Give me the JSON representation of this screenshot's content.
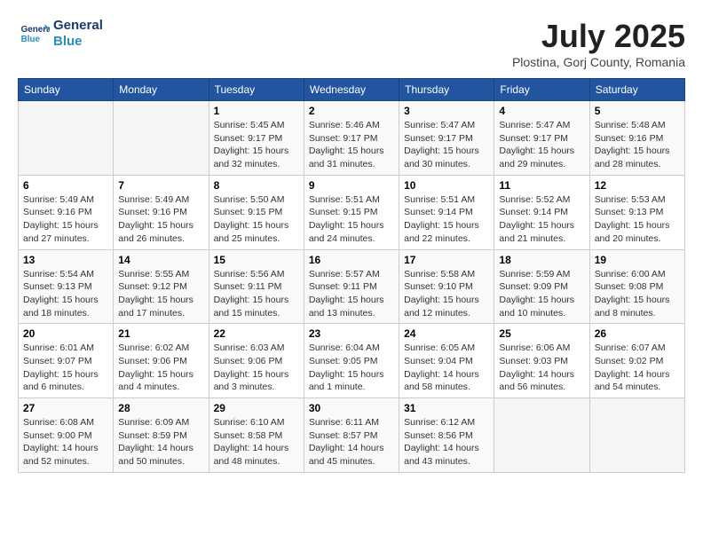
{
  "header": {
    "logo_line1": "General",
    "logo_line2": "Blue",
    "month_title": "July 2025",
    "location": "Plostina, Gorj County, Romania"
  },
  "weekdays": [
    "Sunday",
    "Monday",
    "Tuesday",
    "Wednesday",
    "Thursday",
    "Friday",
    "Saturday"
  ],
  "weeks": [
    [
      {
        "day": "",
        "info": ""
      },
      {
        "day": "",
        "info": ""
      },
      {
        "day": "1",
        "info": "Sunrise: 5:45 AM\nSunset: 9:17 PM\nDaylight: 15 hours\nand 32 minutes."
      },
      {
        "day": "2",
        "info": "Sunrise: 5:46 AM\nSunset: 9:17 PM\nDaylight: 15 hours\nand 31 minutes."
      },
      {
        "day": "3",
        "info": "Sunrise: 5:47 AM\nSunset: 9:17 PM\nDaylight: 15 hours\nand 30 minutes."
      },
      {
        "day": "4",
        "info": "Sunrise: 5:47 AM\nSunset: 9:17 PM\nDaylight: 15 hours\nand 29 minutes."
      },
      {
        "day": "5",
        "info": "Sunrise: 5:48 AM\nSunset: 9:16 PM\nDaylight: 15 hours\nand 28 minutes."
      }
    ],
    [
      {
        "day": "6",
        "info": "Sunrise: 5:49 AM\nSunset: 9:16 PM\nDaylight: 15 hours\nand 27 minutes."
      },
      {
        "day": "7",
        "info": "Sunrise: 5:49 AM\nSunset: 9:16 PM\nDaylight: 15 hours\nand 26 minutes."
      },
      {
        "day": "8",
        "info": "Sunrise: 5:50 AM\nSunset: 9:15 PM\nDaylight: 15 hours\nand 25 minutes."
      },
      {
        "day": "9",
        "info": "Sunrise: 5:51 AM\nSunset: 9:15 PM\nDaylight: 15 hours\nand 24 minutes."
      },
      {
        "day": "10",
        "info": "Sunrise: 5:51 AM\nSunset: 9:14 PM\nDaylight: 15 hours\nand 22 minutes."
      },
      {
        "day": "11",
        "info": "Sunrise: 5:52 AM\nSunset: 9:14 PM\nDaylight: 15 hours\nand 21 minutes."
      },
      {
        "day": "12",
        "info": "Sunrise: 5:53 AM\nSunset: 9:13 PM\nDaylight: 15 hours\nand 20 minutes."
      }
    ],
    [
      {
        "day": "13",
        "info": "Sunrise: 5:54 AM\nSunset: 9:13 PM\nDaylight: 15 hours\nand 18 minutes."
      },
      {
        "day": "14",
        "info": "Sunrise: 5:55 AM\nSunset: 9:12 PM\nDaylight: 15 hours\nand 17 minutes."
      },
      {
        "day": "15",
        "info": "Sunrise: 5:56 AM\nSunset: 9:11 PM\nDaylight: 15 hours\nand 15 minutes."
      },
      {
        "day": "16",
        "info": "Sunrise: 5:57 AM\nSunset: 9:11 PM\nDaylight: 15 hours\nand 13 minutes."
      },
      {
        "day": "17",
        "info": "Sunrise: 5:58 AM\nSunset: 9:10 PM\nDaylight: 15 hours\nand 12 minutes."
      },
      {
        "day": "18",
        "info": "Sunrise: 5:59 AM\nSunset: 9:09 PM\nDaylight: 15 hours\nand 10 minutes."
      },
      {
        "day": "19",
        "info": "Sunrise: 6:00 AM\nSunset: 9:08 PM\nDaylight: 15 hours\nand 8 minutes."
      }
    ],
    [
      {
        "day": "20",
        "info": "Sunrise: 6:01 AM\nSunset: 9:07 PM\nDaylight: 15 hours\nand 6 minutes."
      },
      {
        "day": "21",
        "info": "Sunrise: 6:02 AM\nSunset: 9:06 PM\nDaylight: 15 hours\nand 4 minutes."
      },
      {
        "day": "22",
        "info": "Sunrise: 6:03 AM\nSunset: 9:06 PM\nDaylight: 15 hours\nand 3 minutes."
      },
      {
        "day": "23",
        "info": "Sunrise: 6:04 AM\nSunset: 9:05 PM\nDaylight: 15 hours\nand 1 minute."
      },
      {
        "day": "24",
        "info": "Sunrise: 6:05 AM\nSunset: 9:04 PM\nDaylight: 14 hours\nand 58 minutes."
      },
      {
        "day": "25",
        "info": "Sunrise: 6:06 AM\nSunset: 9:03 PM\nDaylight: 14 hours\nand 56 minutes."
      },
      {
        "day": "26",
        "info": "Sunrise: 6:07 AM\nSunset: 9:02 PM\nDaylight: 14 hours\nand 54 minutes."
      }
    ],
    [
      {
        "day": "27",
        "info": "Sunrise: 6:08 AM\nSunset: 9:00 PM\nDaylight: 14 hours\nand 52 minutes."
      },
      {
        "day": "28",
        "info": "Sunrise: 6:09 AM\nSunset: 8:59 PM\nDaylight: 14 hours\nand 50 minutes."
      },
      {
        "day": "29",
        "info": "Sunrise: 6:10 AM\nSunset: 8:58 PM\nDaylight: 14 hours\nand 48 minutes."
      },
      {
        "day": "30",
        "info": "Sunrise: 6:11 AM\nSunset: 8:57 PM\nDaylight: 14 hours\nand 45 minutes."
      },
      {
        "day": "31",
        "info": "Sunrise: 6:12 AM\nSunset: 8:56 PM\nDaylight: 14 hours\nand 43 minutes."
      },
      {
        "day": "",
        "info": ""
      },
      {
        "day": "",
        "info": ""
      }
    ]
  ]
}
